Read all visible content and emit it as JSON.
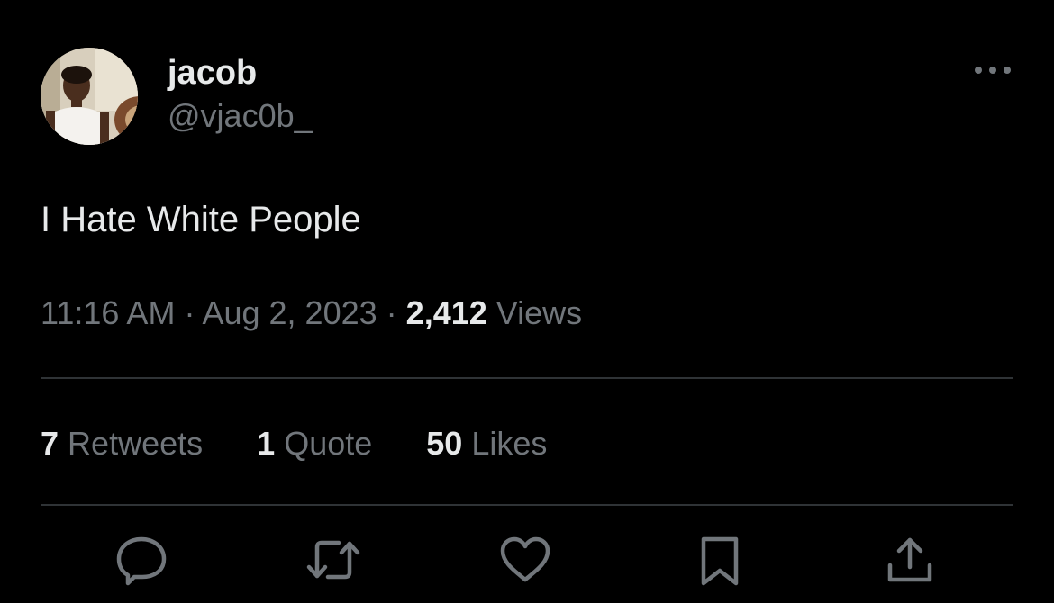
{
  "user": {
    "display_name": "jacob",
    "handle": "@vjac0b_"
  },
  "tweet": {
    "text": "I Hate White People",
    "time": "11:16 AM",
    "date": "Aug 2, 2023",
    "separator": "·",
    "views_count": "2,412",
    "views_label": "Views"
  },
  "stats": {
    "retweets_count": "7",
    "retweets_label": "Retweets",
    "quotes_count": "1",
    "quotes_label": "Quote",
    "likes_count": "50",
    "likes_label": "Likes"
  },
  "icons": {
    "more": "more-horizontal-icon",
    "reply": "reply-icon",
    "retweet": "retweet-icon",
    "like": "heart-icon",
    "bookmark": "bookmark-icon",
    "share": "share-icon"
  },
  "colors": {
    "background": "#000000",
    "primary_text": "#e7e9ea",
    "secondary_text": "#71767b",
    "divider": "#2f3336"
  }
}
